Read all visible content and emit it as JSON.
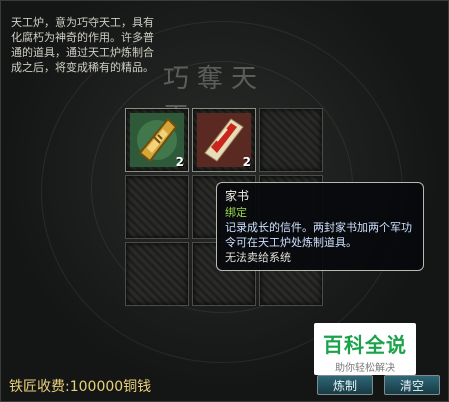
{
  "description": "天工炉，意为巧夺天工，具有化腐朽为神奇的作用。许多普通的道具，通过天工炉炼制合成之后，将变成稀有的精品。",
  "title_glyphs": "巧奪天工",
  "slots": [
    {
      "item": "talisman",
      "count": "2"
    },
    {
      "item": "letter",
      "count": "2"
    },
    {
      "item": "",
      "count": ""
    },
    {
      "item": "",
      "count": ""
    },
    {
      "item": "",
      "count": ""
    },
    {
      "item": "",
      "count": ""
    },
    {
      "item": "",
      "count": ""
    },
    {
      "item": "",
      "count": ""
    },
    {
      "item": "",
      "count": ""
    }
  ],
  "tooltip": {
    "title": "家书",
    "bound": "绑定",
    "desc": "记录成长的信件。两封家书加两个军功令可在天工炉处炼制道具。",
    "note": "无法卖给系统"
  },
  "watermark": {
    "main": "百科全说",
    "sub": "助你轻松解决"
  },
  "fee_label": "铁匠收费:100000铜钱",
  "buttons": {
    "craft": "炼制",
    "clear": "清空"
  },
  "colors": {
    "fee": "#e8d07a",
    "bound": "#9ad94a",
    "tooltip_desc": "#cde1ff"
  }
}
